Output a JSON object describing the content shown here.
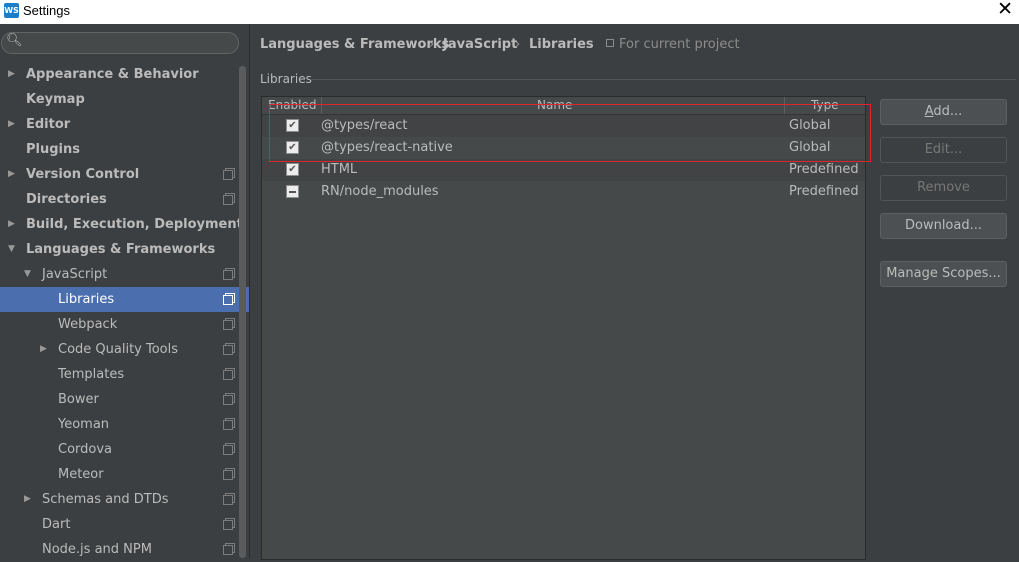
{
  "window": {
    "title": "Settings",
    "app_icon_text": "WS"
  },
  "sidebar": {
    "search_placeholder": "",
    "items": [
      {
        "label": "Appearance & Behavior",
        "level": 0,
        "bold": true,
        "expander": "collapsed",
        "project_icon": false
      },
      {
        "label": "Keymap",
        "level": 0,
        "bold": true,
        "expander": "none",
        "project_icon": false
      },
      {
        "label": "Editor",
        "level": 0,
        "bold": true,
        "expander": "collapsed",
        "project_icon": false
      },
      {
        "label": "Plugins",
        "level": 0,
        "bold": true,
        "expander": "none",
        "project_icon": false
      },
      {
        "label": "Version Control",
        "level": 0,
        "bold": true,
        "expander": "collapsed",
        "project_icon": true
      },
      {
        "label": "Directories",
        "level": 0,
        "bold": true,
        "expander": "none",
        "project_icon": true
      },
      {
        "label": "Build, Execution, Deployment",
        "level": 0,
        "bold": true,
        "expander": "collapsed",
        "project_icon": false
      },
      {
        "label": "Languages & Frameworks",
        "level": 0,
        "bold": true,
        "expander": "expanded",
        "project_icon": false
      },
      {
        "label": "JavaScript",
        "level": 1,
        "bold": false,
        "expander": "expanded",
        "project_icon": true
      },
      {
        "label": "Libraries",
        "level": 2,
        "bold": false,
        "expander": "none",
        "project_icon": true,
        "selected": true
      },
      {
        "label": "Webpack",
        "level": 2,
        "bold": false,
        "expander": "none",
        "project_icon": true
      },
      {
        "label": "Code Quality Tools",
        "level": 2,
        "bold": false,
        "expander": "collapsed",
        "project_icon": true
      },
      {
        "label": "Templates",
        "level": 2,
        "bold": false,
        "expander": "none",
        "project_icon": true
      },
      {
        "label": "Bower",
        "level": 2,
        "bold": false,
        "expander": "none",
        "project_icon": true
      },
      {
        "label": "Yeoman",
        "level": 2,
        "bold": false,
        "expander": "none",
        "project_icon": true
      },
      {
        "label": "Cordova",
        "level": 2,
        "bold": false,
        "expander": "none",
        "project_icon": true
      },
      {
        "label": "Meteor",
        "level": 2,
        "bold": false,
        "expander": "none",
        "project_icon": true
      },
      {
        "label": "Schemas and DTDs",
        "level": 1,
        "bold": false,
        "expander": "collapsed",
        "project_icon": true
      },
      {
        "label": "Dart",
        "level": 1,
        "bold": false,
        "expander": "none",
        "project_icon": true
      },
      {
        "label": "Node.js and NPM",
        "level": 1,
        "bold": false,
        "expander": "none",
        "project_icon": true
      }
    ]
  },
  "breadcrumb": {
    "items": [
      "Languages & Frameworks",
      "JavaScript",
      "Libraries"
    ],
    "separator": "›",
    "scope_hint": "For current project"
  },
  "libraries": {
    "section_label": "Libraries",
    "columns": [
      "Enabled",
      "Name",
      "Type"
    ],
    "rows": [
      {
        "enabled": "checked",
        "name": "@types/react",
        "type": "Global"
      },
      {
        "enabled": "checked",
        "name": "@types/react-native",
        "type": "Global"
      },
      {
        "enabled": "checked",
        "name": "HTML",
        "type": "Predefined"
      },
      {
        "enabled": "partial",
        "name": "RN/node_modules",
        "type": "Predefined"
      }
    ]
  },
  "buttons": {
    "add": "Add...",
    "edit": "Edit...",
    "remove": "Remove",
    "download": "Download...",
    "manage_scopes": "Manage Scopes..."
  },
  "colors": {
    "background": "#3c3f41",
    "selection": "#4b6eaf",
    "highlight_box": "#e0242a"
  }
}
